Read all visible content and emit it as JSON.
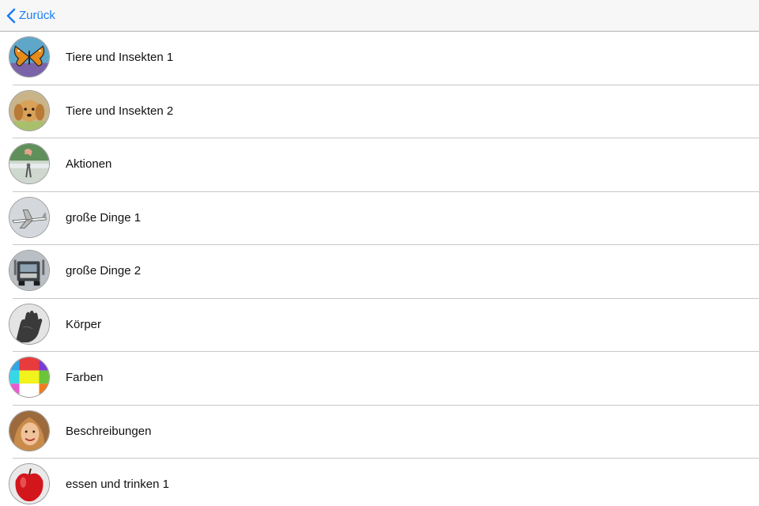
{
  "navbar": {
    "back_label": "Zurück",
    "accent_color": "#1a7ef5"
  },
  "categories": [
    {
      "label": "Tiere und Insekten 1",
      "icon": "butterfly-icon"
    },
    {
      "label": "Tiere und Insekten 2",
      "icon": "puppy-icon"
    },
    {
      "label": "Aktionen",
      "icon": "hand-action-icon"
    },
    {
      "label": "große Dinge 1",
      "icon": "airplane-icon"
    },
    {
      "label": "große Dinge 2",
      "icon": "truck-icon"
    },
    {
      "label": "Körper",
      "icon": "hand-icon"
    },
    {
      "label": "Farben",
      "icon": "color-grid-icon"
    },
    {
      "label": "Beschreibungen",
      "icon": "smiling-woman-icon"
    },
    {
      "label": "essen und trinken 1",
      "icon": "apple-icon"
    }
  ]
}
